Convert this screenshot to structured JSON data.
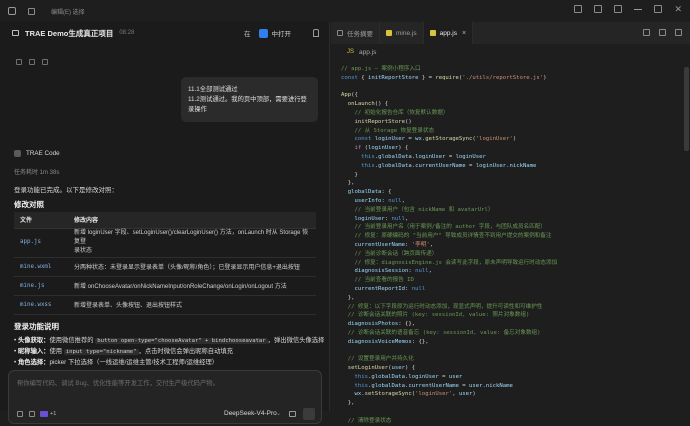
{
  "titlebar": {
    "menu_text": "编辑(E) 选择"
  },
  "left": {
    "title": "TRAE Demo生成真正项目",
    "time": "08:28",
    "in_label": "在",
    "open_label": "中打开",
    "user_message": [
      "11.1全部测试通过",
      "11.2测试通过。我的页中顶部，需要进行登录操作"
    ],
    "assistant_name": "TRAE Code",
    "task_line": "任务耗时 1m 38s",
    "done_text": "登录功能已完成。以下是修改对照：",
    "compare_heading": "修改对照",
    "table": {
      "headers": [
        "文件",
        "修改内容"
      ],
      "rows": [
        {
          "file": "app.js",
          "lines": [
            "新增 loginUser 字段、setLoginUser()/clearLoginUser() 方法，onLaunch 时从 Storage 恢复登",
            "录状态"
          ]
        },
        {
          "file": "mine.wxml",
          "lines": [
            "分两种状态：未登录显示登录表单（头像/昵称/角色）；已登录显示用户信息+退出按钮"
          ]
        },
        {
          "file": "mine.js",
          "lines": [
            "新增 onChooseAvatar/onNickNameInput/onRoleChange/onLogin/onLogout 方法"
          ]
        },
        {
          "file": "mine.wxss",
          "lines": [
            "新增登录表单、头像按钮、退出按钮样式"
          ]
        }
      ]
    },
    "login_heading": "登录功能说明",
    "bullets": [
      {
        "label": "头像获取：",
        "pre": "使用微信推荐的 ",
        "code": "button open-type=\"chooseAvatar\" + bindchooseavatar",
        "post": "，弹出微信头像选择"
      },
      {
        "label": "昵称输入：",
        "pre": "使用 ",
        "code": "input type=\"nickname\"",
        "post": "，点击时微信会弹出昵称自动填充"
      },
      {
        "label": "角色选择：",
        "pre": "picker 下拉选择（一线运维/运维主管/技术工程师/运维经理）",
        "code": "",
        "post": ""
      }
    ],
    "input_placeholder": "帮你编写代码、调试 Bug、优化性能等开发工作，交付生产级代码产物。",
    "badge_count": "+1",
    "model_name": "DeepSeek-V4-Pro"
  },
  "editor": {
    "tabs": [
      {
        "label": "任务摘要",
        "active": false
      },
      {
        "label": "mine.js",
        "active": false
      },
      {
        "label": "app.js",
        "active": true
      }
    ],
    "breadcrumb_js": "JS",
    "breadcrumb_file": "app.js",
    "code_lines": [
      [
        [
          "c-com",
          "// app.js — 案例小程序入口"
        ]
      ],
      [
        [
          "c-kw",
          "const"
        ],
        [
          "",
          " { "
        ],
        [
          "c-var",
          "initReportStore"
        ],
        [
          "",
          " } = "
        ],
        [
          "c-fn",
          "require"
        ],
        [
          "",
          "("
        ],
        [
          "c-str",
          "'./utils/reportStore.js'"
        ],
        [
          "",
          ")"
        ]
      ],
      [
        [
          "",
          ""
        ]
      ],
      [
        [
          "c-fn",
          "App"
        ],
        [
          "",
          "({"
        ]
      ],
      [
        [
          "",
          "  "
        ],
        [
          "c-fn",
          "onLaunch"
        ],
        [
          "",
          "() {"
        ]
      ],
      [
        [
          "c-com",
          "    // 初始化报告仓库（恢复默认数据）"
        ]
      ],
      [
        [
          "",
          "    "
        ],
        [
          "c-fn",
          "initReportStore"
        ],
        [
          "",
          "()"
        ]
      ],
      [
        [
          "c-com",
          "    // 从 Storage 恢复登录状态"
        ]
      ],
      [
        [
          "",
          "    "
        ],
        [
          "c-kw",
          "const"
        ],
        [
          "",
          " "
        ],
        [
          "c-var",
          "loginUser"
        ],
        [
          "",
          " = "
        ],
        [
          "c-var",
          "wx"
        ],
        [
          "",
          "."
        ],
        [
          "c-fn",
          "getStorageSync"
        ],
        [
          "",
          "("
        ],
        [
          "c-str",
          "'loginUser'"
        ],
        [
          "",
          ")"
        ]
      ],
      [
        [
          "",
          "    "
        ],
        [
          "c-kw2",
          "if"
        ],
        [
          "",
          " ("
        ],
        [
          "c-var",
          "loginUser"
        ],
        [
          "",
          ") {"
        ]
      ],
      [
        [
          "",
          "      "
        ],
        [
          "c-kw",
          "this"
        ],
        [
          "",
          "."
        ],
        [
          "c-var",
          "globalData"
        ],
        [
          "",
          "."
        ],
        [
          "c-var",
          "loginUser"
        ],
        [
          "",
          " = "
        ],
        [
          "c-var",
          "loginUser"
        ]
      ],
      [
        [
          "",
          "      "
        ],
        [
          "c-kw",
          "this"
        ],
        [
          "",
          "."
        ],
        [
          "c-var",
          "globalData"
        ],
        [
          "",
          "."
        ],
        [
          "c-var",
          "currentUserName"
        ],
        [
          "",
          " = "
        ],
        [
          "c-var",
          "loginUser"
        ],
        [
          "",
          "."
        ],
        [
          "c-var",
          "nickName"
        ]
      ],
      [
        [
          "",
          "    }"
        ]
      ],
      [
        [
          "",
          "  },"
        ]
      ],
      [
        [
          "",
          "  "
        ],
        [
          "c-var",
          "globalData"
        ],
        [
          "",
          ": {"
        ]
      ],
      [
        [
          "",
          "    "
        ],
        [
          "c-var",
          "userInfo"
        ],
        [
          "",
          ": "
        ],
        [
          "c-kw",
          "null"
        ],
        [
          "",
          ","
        ]
      ],
      [
        [
          "c-com",
          "    // 当前登录用户（包含 nickName 和 avatarUrl）"
        ]
      ],
      [
        [
          "",
          "    "
        ],
        [
          "c-var",
          "loginUser"
        ],
        [
          "",
          ": "
        ],
        [
          "c-kw",
          "null"
        ],
        [
          "",
          ","
        ]
      ],
      [
        [
          "c-com",
          "    // 当前登录用户名（用于案例/备注的 author 字段，与团队成员名匹配）"
        ]
      ],
      [
        [
          "c-com",
          "    // 修复：原硬编码的 \"当前用户\" 导致成员详情查不到用户提交的案例和备注"
        ]
      ],
      [
        [
          "",
          "    "
        ],
        [
          "c-var",
          "currentUserName"
        ],
        [
          "",
          ": "
        ],
        [
          "c-str",
          "'李明'"
        ],
        [
          "",
          ","
        ]
      ],
      [
        [
          "c-com",
          "    // 当前诊断会话（跨页面传递）"
        ]
      ],
      [
        [
          "c-com",
          "    // 修复：diagnosisEngine.js 会读写此字段，原未声明导致运行时动态添加"
        ]
      ],
      [
        [
          "",
          "    "
        ],
        [
          "c-var",
          "diagnosisSession"
        ],
        [
          "",
          ": "
        ],
        [
          "c-kw",
          "null"
        ],
        [
          "",
          ","
        ]
      ],
      [
        [
          "c-com",
          "    // 当前查看的报告 ID"
        ]
      ],
      [
        [
          "",
          "    "
        ],
        [
          "c-var",
          "currentReportId"
        ],
        [
          "",
          ": "
        ],
        [
          "c-kw",
          "null"
        ]
      ],
      [
        [
          "",
          "  },"
        ]
      ],
      [
        [
          "c-com",
          "  // 修复：以下字段原为运行时动态添加，现显式声明，提升可读性和可维护性"
        ]
      ],
      [
        [
          "c-com",
          "  // 诊断会话关联的照片 (key: sessionId, value: 照片对象数组)"
        ]
      ],
      [
        [
          "",
          "  "
        ],
        [
          "c-var",
          "diagnosisPhotos"
        ],
        [
          "",
          ": {},"
        ]
      ],
      [
        [
          "c-com",
          "  // 诊断会话关联的语音备忘 (key: sessionId, value: 备忘对象数组)"
        ]
      ],
      [
        [
          "",
          "  "
        ],
        [
          "c-var",
          "diagnosisVoiceMemos"
        ],
        [
          "",
          ": {},"
        ]
      ],
      [
        [
          "",
          ""
        ]
      ],
      [
        [
          "c-com",
          "  // 设置登录用户并持久化"
        ]
      ],
      [
        [
          "",
          "  "
        ],
        [
          "c-fn",
          "setLoginUser"
        ],
        [
          "",
          "("
        ],
        [
          "c-var",
          "user"
        ],
        [
          "",
          ") {"
        ]
      ],
      [
        [
          "",
          "    "
        ],
        [
          "c-kw",
          "this"
        ],
        [
          "",
          "."
        ],
        [
          "c-var",
          "globalData"
        ],
        [
          "",
          "."
        ],
        [
          "c-var",
          "loginUser"
        ],
        [
          "",
          " = "
        ],
        [
          "c-var",
          "user"
        ]
      ],
      [
        [
          "",
          "    "
        ],
        [
          "c-kw",
          "this"
        ],
        [
          "",
          "."
        ],
        [
          "c-var",
          "globalData"
        ],
        [
          "",
          "."
        ],
        [
          "c-var",
          "currentUserName"
        ],
        [
          "",
          " = "
        ],
        [
          "c-var",
          "user"
        ],
        [
          "",
          "."
        ],
        [
          "c-var",
          "nickName"
        ]
      ],
      [
        [
          "",
          "    "
        ],
        [
          "c-var",
          "wx"
        ],
        [
          "",
          "."
        ],
        [
          "c-fn",
          "setStorageSync"
        ],
        [
          "",
          "("
        ],
        [
          "c-str",
          "'loginUser'"
        ],
        [
          "",
          ", "
        ],
        [
          "c-var",
          "user"
        ],
        [
          "",
          ")"
        ]
      ],
      [
        [
          "",
          "  },"
        ]
      ],
      [
        [
          "",
          ""
        ]
      ],
      [
        [
          "c-com",
          "  // 清除登录状态"
        ]
      ]
    ]
  }
}
